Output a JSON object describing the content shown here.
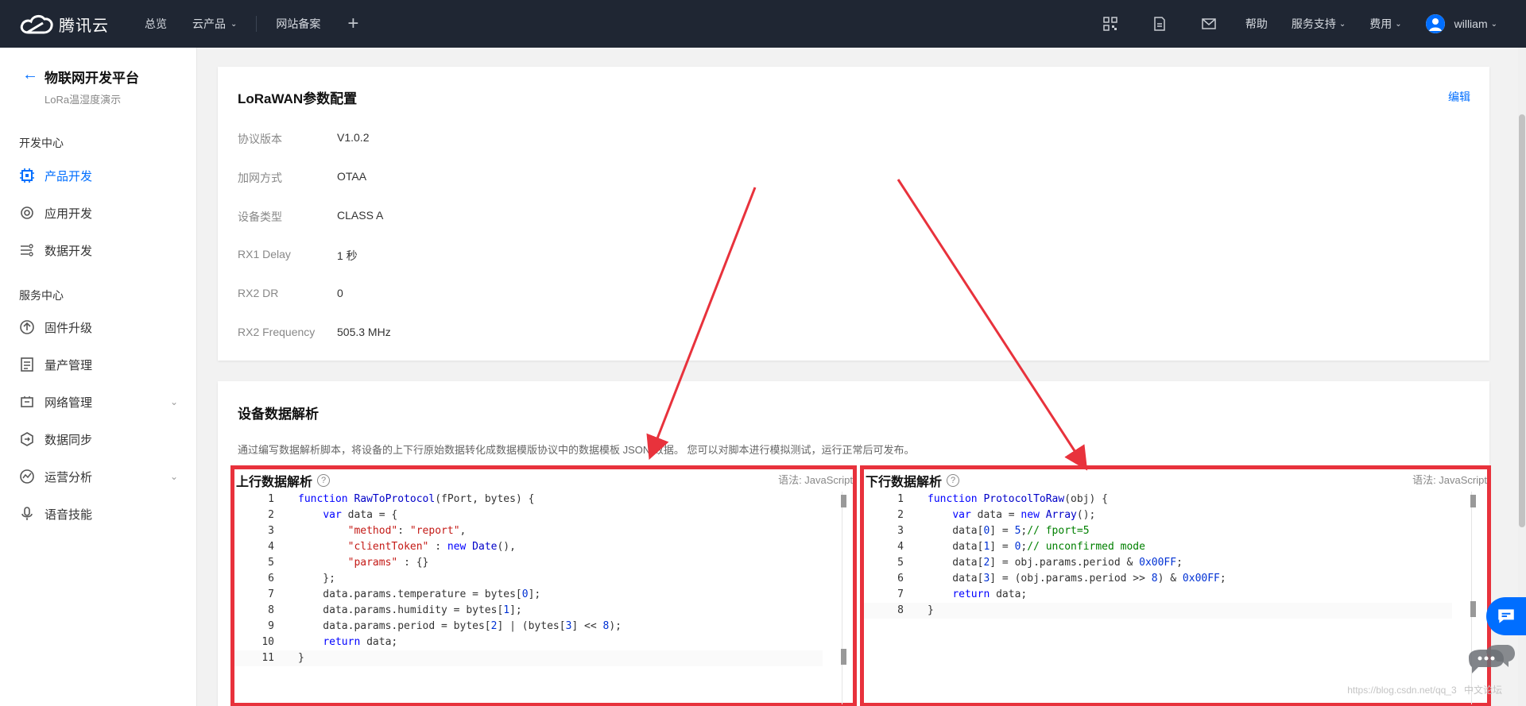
{
  "topbar": {
    "logo_text": "腾讯云",
    "nav": [
      "总览",
      "云产品",
      "网站备案"
    ],
    "plus": "+",
    "right": {
      "help": "帮助",
      "support": "服务支持",
      "billing": "费用",
      "user": "william"
    }
  },
  "sidebar": {
    "back_arrow": "←",
    "title": "物联网开发平台",
    "subtitle": "LoRa温湿度演示",
    "group1": "开发中心",
    "group2": "服务中心",
    "items": [
      {
        "label": "产品开发",
        "icon": "chip-icon",
        "active": true
      },
      {
        "label": "应用开发",
        "icon": "gear-icon"
      },
      {
        "label": "数据开发",
        "icon": "flow-icon"
      },
      {
        "label": "固件升级",
        "icon": "upgrade-icon"
      },
      {
        "label": "量产管理",
        "icon": "list-icon"
      },
      {
        "label": "网络管理",
        "icon": "network-icon",
        "chevron": true
      },
      {
        "label": "数据同步",
        "icon": "sync-icon"
      },
      {
        "label": "运营分析",
        "icon": "analytics-icon",
        "chevron": true
      },
      {
        "label": "语音技能",
        "icon": "voice-icon"
      }
    ]
  },
  "lorawan": {
    "title": "LoRaWAN参数配置",
    "edit": "编辑",
    "rows": [
      {
        "key": "协议版本",
        "value": "V1.0.2"
      },
      {
        "key": "加网方式",
        "value": "OTAA"
      },
      {
        "key": "设备类型",
        "value": "CLASS A"
      },
      {
        "key": "RX1 Delay",
        "value": "1 秒"
      },
      {
        "key": "RX2 DR",
        "value": "0"
      },
      {
        "key": "RX2 Frequency",
        "value": "505.3 MHz"
      }
    ]
  },
  "parser": {
    "title": "设备数据解析",
    "description": "通过编写数据解析脚本，将设备的上下行原始数据转化成数据模版协议中的数据模板 JSON 数据。 您可以对脚本进行模拟测试，运行正常后可发布。",
    "uplink": {
      "title": "上行数据解析",
      "syntax": "语法: JavaScript",
      "lines": [
        [
          [
            "kw",
            "function "
          ],
          [
            "fn",
            "RawToProtocol"
          ],
          [
            "",
            "(fPort, bytes) {"
          ]
        ],
        [
          [
            "",
            "    "
          ],
          [
            "kw",
            "var"
          ],
          [
            "",
            " data = {"
          ]
        ],
        [
          [
            "",
            "        "
          ],
          [
            "str",
            "\"method\""
          ],
          [
            "",
            ": "
          ],
          [
            "str",
            "\"report\""
          ],
          [
            "",
            ","
          ]
        ],
        [
          [
            "",
            "        "
          ],
          [
            "str",
            "\"clientToken\""
          ],
          [
            "",
            " : "
          ],
          [
            "kw",
            "new "
          ],
          [
            "fn",
            "Date"
          ],
          [
            "",
            "(),"
          ]
        ],
        [
          [
            "",
            "        "
          ],
          [
            "str",
            "\"params\""
          ],
          [
            "",
            " : {}"
          ]
        ],
        [
          [
            "",
            "    };"
          ]
        ],
        [
          [
            "",
            "    data.params.temperature = bytes["
          ],
          [
            "num",
            "0"
          ],
          [
            "",
            "];"
          ]
        ],
        [
          [
            "",
            "    data.params.humidity = bytes["
          ],
          [
            "num",
            "1"
          ],
          [
            "",
            "];"
          ]
        ],
        [
          [
            "",
            "    data.params.period = bytes["
          ],
          [
            "num",
            "2"
          ],
          [
            "",
            "] | (bytes["
          ],
          [
            "num",
            "3"
          ],
          [
            "",
            "] << "
          ],
          [
            "num",
            "8"
          ],
          [
            "",
            ");"
          ]
        ],
        [
          [
            "",
            "    "
          ],
          [
            "kw",
            "return"
          ],
          [
            "",
            " data;"
          ]
        ],
        [
          [
            "",
            "}"
          ]
        ]
      ]
    },
    "downlink": {
      "title": "下行数据解析",
      "syntax": "语法: JavaScript",
      "lines": [
        [
          [
            "kw",
            "function "
          ],
          [
            "fn",
            "ProtocolToRaw"
          ],
          [
            "",
            "(obj) {"
          ]
        ],
        [
          [
            "",
            "    "
          ],
          [
            "kw",
            "var"
          ],
          [
            "",
            " data = "
          ],
          [
            "kw",
            "new "
          ],
          [
            "fn",
            "Array"
          ],
          [
            "",
            "();"
          ]
        ],
        [
          [
            "",
            "    data["
          ],
          [
            "num",
            "0"
          ],
          [
            "",
            "] = "
          ],
          [
            "num",
            "5"
          ],
          [
            "",
            ";"
          ],
          [
            "cm",
            "// fport=5"
          ]
        ],
        [
          [
            "",
            "    data["
          ],
          [
            "num",
            "1"
          ],
          [
            "",
            "] = "
          ],
          [
            "num",
            "0"
          ],
          [
            "",
            ";"
          ],
          [
            "cm",
            "// unconfirmed mode"
          ]
        ],
        [
          [
            "",
            "    data["
          ],
          [
            "num",
            "2"
          ],
          [
            "",
            "] = obj.params.period & "
          ],
          [
            "num",
            "0x00FF"
          ],
          [
            "",
            ";"
          ]
        ],
        [
          [
            "",
            "    data["
          ],
          [
            "num",
            "3"
          ],
          [
            "",
            "] = (obj.params.period >> "
          ],
          [
            "num",
            "8"
          ],
          [
            "",
            ") & "
          ],
          [
            "num",
            "0x00FF"
          ],
          [
            "",
            ";"
          ]
        ],
        [
          [
            "",
            "    "
          ],
          [
            "kw",
            "return"
          ],
          [
            "",
            " data;"
          ]
        ],
        [
          [
            "",
            "}"
          ]
        ]
      ]
    }
  },
  "watermark": "https://blog.csdn.net/qq_3",
  "watermark2": "中文论坛",
  "colors": {
    "accent": "#006eff",
    "annotation": "#e8323c",
    "topbar": "#1f2633"
  }
}
